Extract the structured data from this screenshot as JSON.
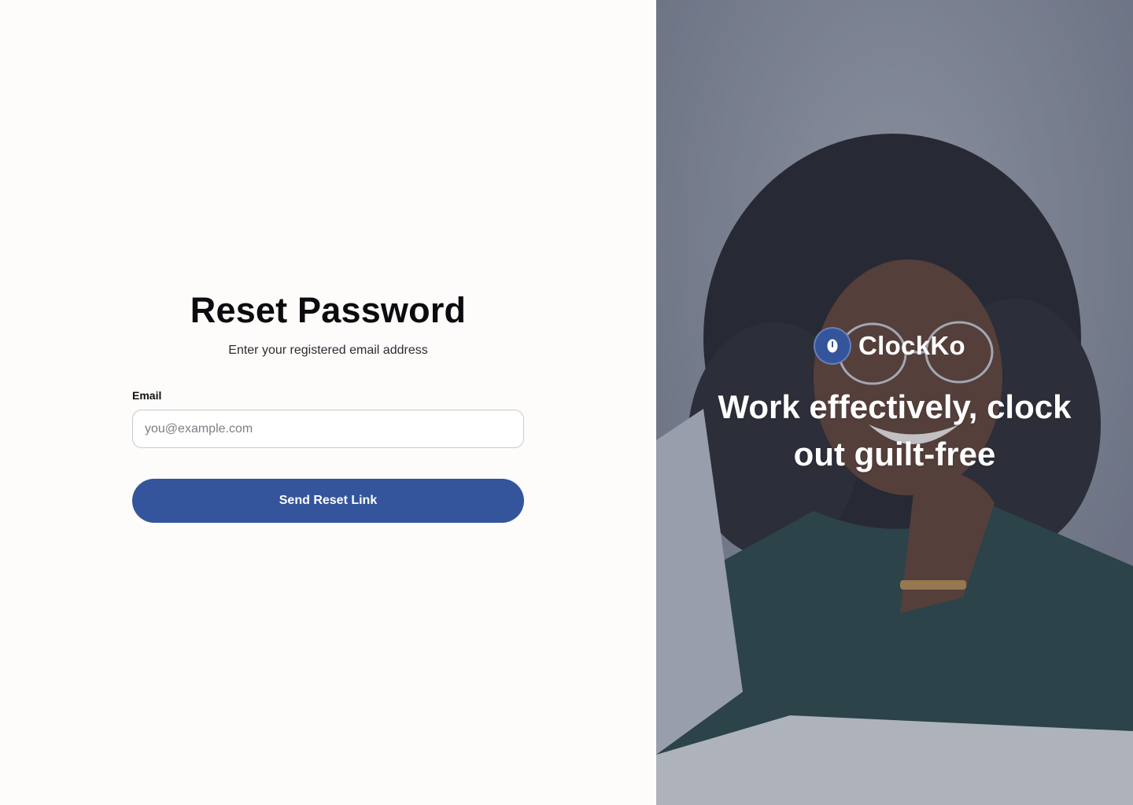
{
  "reset_form": {
    "title": "Reset Password",
    "subtitle": "Enter your registered email address",
    "email_label": "Email",
    "email_value": "",
    "email_placeholder": "you@example.com",
    "submit_label": "Send Reset Link"
  },
  "hero": {
    "brand_name": "ClockKo",
    "tagline": "Work effectively, clock out guilt-free",
    "logo_icon": "clock-icon"
  },
  "colors": {
    "accent": "#34559c",
    "background": "#fdfcfa",
    "hero_overlay": "#7f8593"
  }
}
